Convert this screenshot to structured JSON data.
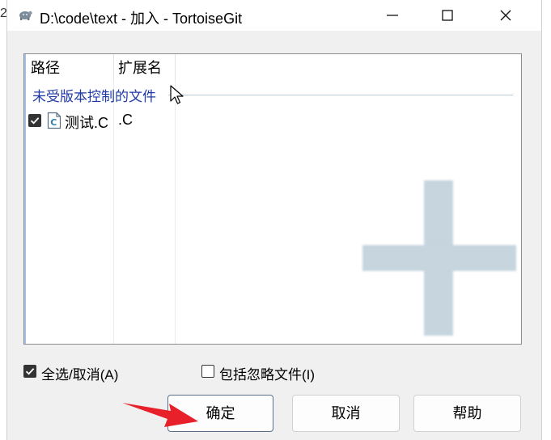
{
  "window": {
    "title": "D:\\code\\text - 加入 - TortoiseGit"
  },
  "edge_fragment": "2",
  "list": {
    "columns": [
      "路径",
      "扩展名"
    ],
    "group_label": "未受版本控制的文件",
    "items": [
      {
        "name": "测试.C",
        "ext": ".C",
        "checked": true,
        "icon": "c-source-file-icon"
      }
    ]
  },
  "options": {
    "select_all_label": "全选/取消(A)",
    "select_all_checked": true,
    "include_ignored_label": "包括忽略文件(I)",
    "include_ignored_checked": false
  },
  "buttons": {
    "ok": "确定",
    "cancel": "取消",
    "help": "帮助"
  },
  "colors": {
    "group_text": "#1f3aa6",
    "watermark_plus": "#c6d5de",
    "arrow": "#e8202a"
  }
}
